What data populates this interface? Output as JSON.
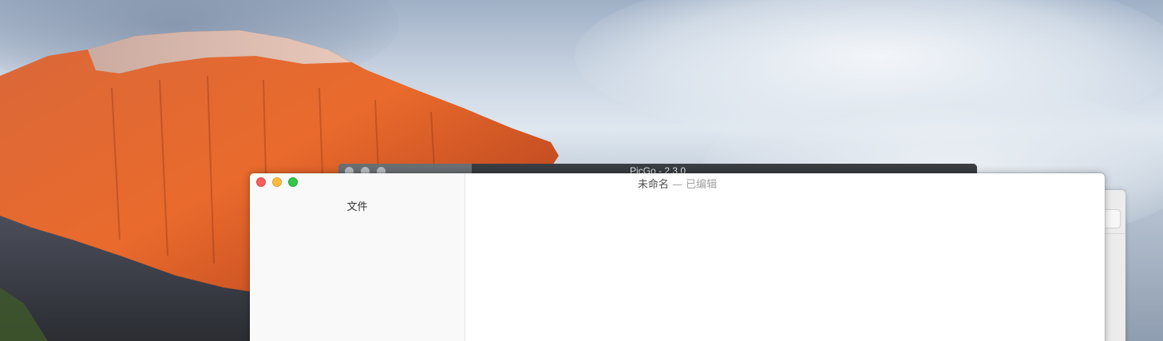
{
  "background_windows": {
    "picgo": {
      "title": "PicGo - 2.3.0"
    }
  },
  "editor": {
    "document_name": "未命名",
    "separator": " — ",
    "status": "已编辑",
    "sidebar": {
      "tab_label": "文件"
    },
    "content": ""
  },
  "colors": {
    "close": "#fc605c",
    "minimize": "#fdbc40",
    "maximize": "#34c84a",
    "sidebar_bg": "#f9f9f9",
    "picgo_titlebar": "#33373b"
  }
}
